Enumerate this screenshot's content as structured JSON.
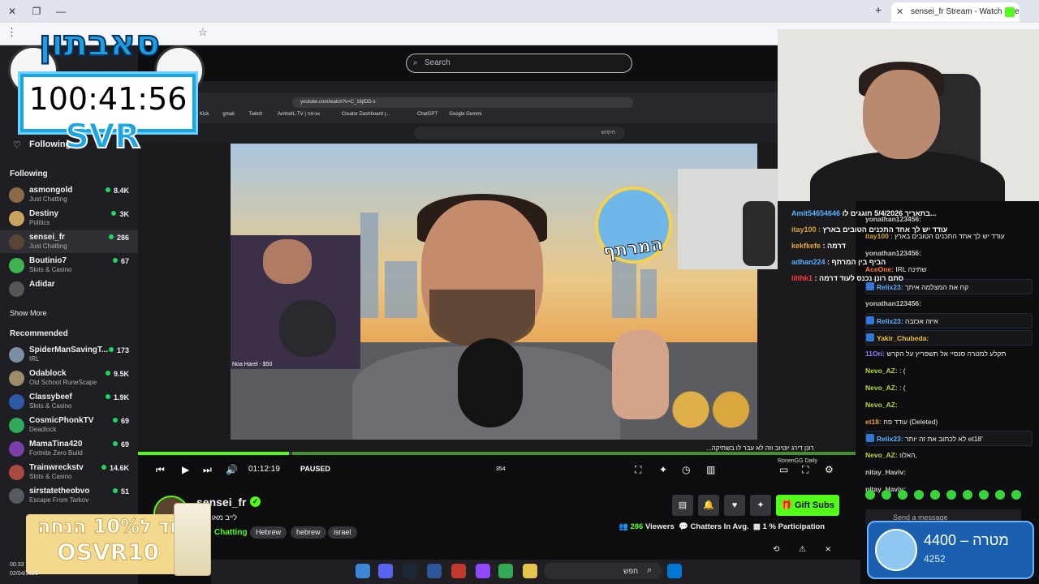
{
  "browser": {
    "tab_title": "sensei_fr Stream - Watch Live o",
    "window_controls": [
      "close",
      "restore",
      "minimize"
    ],
    "new_tab_label": "+"
  },
  "nav": {
    "following_label": "Following",
    "search_placeholder": "Search"
  },
  "sidebar": {
    "following_header": "Following",
    "following": [
      {
        "name": "asmongold",
        "game": "Just Chatting",
        "viewers": "8.4K",
        "color": "#8b6b4a"
      },
      {
        "name": "Destiny",
        "game": "Politics",
        "viewers": "3K",
        "color": "#c9a25e"
      },
      {
        "name": "sensei_fr",
        "game": "Just Chatting",
        "viewers": "286",
        "color": "#5a4534"
      },
      {
        "name": "Boutinio7",
        "game": "Slots & Casino",
        "viewers": "67",
        "color": "#3fb34f"
      },
      {
        "name": "Adidar",
        "game": "",
        "viewers": "",
        "color": "#555555"
      }
    ],
    "show_more": "Show More",
    "recommended_header": "Recommended",
    "recommended": [
      {
        "name": "SpiderManSavingT...",
        "game": "IRL",
        "viewers": "173",
        "color": "#7b8ea6"
      },
      {
        "name": "Odablock",
        "game": "Old School RuneScape",
        "viewers": "9.5K",
        "color": "#9c8c6a"
      },
      {
        "name": "Classybeef",
        "game": "Slots & Casino",
        "viewers": "1.9K",
        "color": "#2d5aa8"
      },
      {
        "name": "CosmicPhonkTV",
        "game": "Deadlock",
        "viewers": "69",
        "color": "#2fa85a"
      },
      {
        "name": "MamaTina420",
        "game": "Fortnite Zero Build",
        "viewers": "69",
        "color": "#7a3fa8"
      },
      {
        "name": "Trainwreckstv",
        "game": "Slots & Casino",
        "viewers": "14.6K",
        "color": "#a84a3f"
      },
      {
        "name": "sirstatetheobvo",
        "game": "Escape From Tarkov",
        "viewers": "51",
        "color": "#555a60"
      }
    ]
  },
  "overlay": {
    "timer": "100:41:56",
    "svr": "SVR",
    "logo_text": "סאבתון",
    "promo_line1": "קוד ל10% הנחה",
    "promo_line2": "OSVR10",
    "goal_amount": "4400",
    "goal_label": "מטרה",
    "goal_current": "4252",
    "goal_dash": "–"
  },
  "video": {
    "inner_url": "youtube.com/watch?v=C_16jtDD-s",
    "inner_search": "חיפוש",
    "bookmarks": [
      "Kick",
      "gmail",
      "Twitch",
      "AnimeIL-TV | אנימה",
      "Creator Dashboard |...",
      "ChatGPT",
      "Google Gemini"
    ],
    "donation": "Noa Harel - $50",
    "badge_label": "המרתף",
    "caption": "...רונן דירג יוטיוב וזה לא עבר לו בשתיקה"
  },
  "player": {
    "timecode": "01:12:19",
    "state": "PAUSED",
    "progress": 0.21,
    "like_count": "354",
    "streamer_chip": "RonenGG Daily"
  },
  "channel": {
    "name": "sensei_fr",
    "title": "לייב מאוחר פ",
    "category": "Chatting",
    "tags": [
      "Hebrew",
      "hebrew",
      "israel"
    ],
    "gift_subs": "Gift Subs",
    "viewers_count": "286",
    "viewers_label": "Viewers",
    "chatters_label": "Chatters In Avg.",
    "participation_count": "1",
    "participation_label": "% Participation"
  },
  "chat": {
    "messages": [
      {
        "user": "yonathan123456:",
        "text": "",
        "color": "#c8c8c8",
        "top": 0
      },
      {
        "user": "itay100",
        "text": ": עודד יש לך אחד התכנים הטובים בארץ",
        "color": "#d4a53a"
      },
      {
        "user": "yonathan123456:",
        "text": "",
        "color": "#c8c8c8"
      },
      {
        "user": "AceOne:",
        "text": "IRL שתינה",
        "color": "#ff7a3c"
      },
      {
        "user": "Relix23:",
        "text": "קח את המצלמה איתך",
        "color": "#5ab0ff",
        "hl": true
      },
      {
        "user": "yonathan123456:",
        "text": "",
        "color": "#c8c8c8"
      },
      {
        "user": "Relix23:",
        "text": "איזה אכזבה",
        "color": "#5ab0ff",
        "hl": true
      },
      {
        "user": "Yakir_Chubeda:",
        "text": "",
        "color": "#f0c24a",
        "hl": true
      },
      {
        "user": "11Ori:",
        "text": "תקלע למטרה סנסיי אל תשפריץ על הקרש",
        "color": "#9f7bff"
      },
      {
        "user": "Nevo_AZ:",
        "text": ": (",
        "color": "#b3d94a"
      },
      {
        "user": "Nevo_AZ:",
        "text": ": (",
        "color": "#b3d94a"
      },
      {
        "user": "Nevo_AZ:",
        "text": "",
        "color": "#b3d94a"
      },
      {
        "user": "et18:",
        "text": "עודד פח (Deleted)",
        "color": "#e8a33a"
      },
      {
        "user": "Relix23:",
        "text": "לא לכתוב את זה יותר et18'",
        "color": "#5ab0ff",
        "hl": true
      },
      {
        "user": "Nevo_AZ:",
        "text": "האלוו,",
        "color": "#b3d94a"
      },
      {
        "user": "nitay_Haviv:",
        "text": "",
        "color": "#c8c8c8"
      },
      {
        "user": "nitay_Haviv:",
        "text": "",
        "color": "#c8c8c8"
      }
    ],
    "input_placeholder": "Send a message",
    "overlay_msgs": [
      {
        "user": "Amit54654646",
        "text": "בתאריך 5/4/2026 חוגגים לו...",
        "color": "#5ab0ff"
      },
      {
        "user": "itay100 :",
        "text": "עודד יש לך אחד התכנים הטובים בארץ",
        "color": "#d4a53a"
      },
      {
        "user": "kekfkefe",
        "text": ": דרמה",
        "color": "#e8a33a"
      },
      {
        "user": "adhan224",
        "text": ": הביף בין המרתף",
        "color": "#5ab0ff"
      },
      {
        "user": "lilthk1",
        "text": ": סתם רונן נכנס לעוד דרמה",
        "color": "#ff3b3b"
      }
    ]
  },
  "taskbar": {
    "search_label": "חפש",
    "time": "00:33",
    "date": "02/04/2026"
  }
}
